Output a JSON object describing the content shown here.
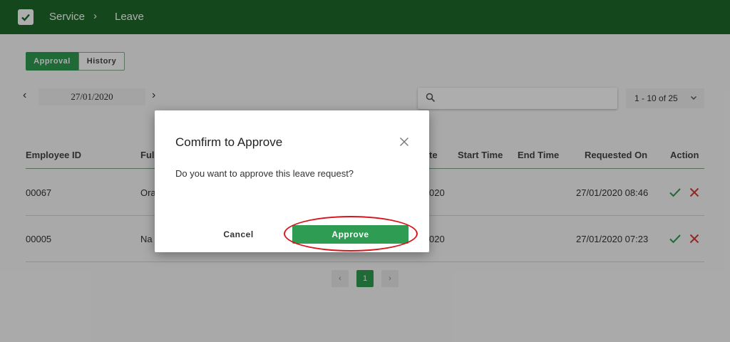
{
  "header": {
    "breadcrumb": [
      "Service",
      "Leave"
    ],
    "separator": "›"
  },
  "tabs": [
    {
      "label": "Approval",
      "active": true
    },
    {
      "label": "History",
      "active": false
    }
  ],
  "date_nav": {
    "prev": "‹",
    "date": "27/01/2020",
    "next": "›"
  },
  "search": {
    "value": "",
    "placeholder": ""
  },
  "pager": {
    "range": "1 - 10 of 25"
  },
  "table": {
    "headers": [
      "Employee ID",
      "Ful",
      "te",
      "Start Time",
      "End Time",
      "Requested On",
      "Action"
    ],
    "rows": [
      {
        "employee_id": "00067",
        "name": "Ora",
        "date": "020",
        "requested_on": "27/01/2020 08:46"
      },
      {
        "employee_id": "00005",
        "name": "Na",
        "date": "020",
        "requested_on": "27/01/2020 07:23"
      }
    ]
  },
  "pagination": {
    "prev": "‹",
    "current": "1",
    "next": "›"
  },
  "dialog": {
    "title": "Comfirm to Approve",
    "message": "Do you want to approve this leave request?",
    "cancel_label": "Cancel",
    "approve_label": "Approve"
  },
  "colors": {
    "appbar": "#1e6b2a",
    "accent": "#2e9c52",
    "reject": "#d83a3a",
    "highlight": "#d8141c"
  },
  "icons": [
    "check-box-icon",
    "chevron-right-icon",
    "search-icon",
    "chevron-down-icon",
    "check-icon",
    "close-icon"
  ]
}
